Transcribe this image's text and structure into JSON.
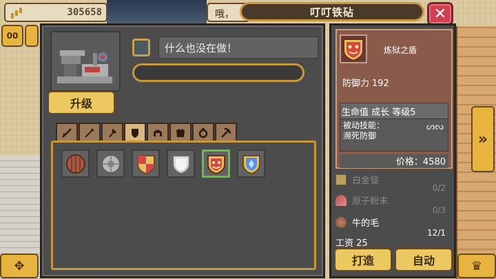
{
  "top_bar": {
    "coins": "305658",
    "message_snippet": "哦，",
    "title": "叮叮铁砧",
    "close_label": "✕"
  },
  "side_buttons": {
    "left_top": "00",
    "right_arrow": "»",
    "bottom_left": "✥",
    "bottom_right": "♛"
  },
  "workshop": {
    "upgrade_label": "升级",
    "status_text": "什么也没在做！",
    "progress": 0
  },
  "tabs": [
    {
      "icon": "sword-icon",
      "active": false
    },
    {
      "icon": "spear-icon",
      "active": false
    },
    {
      "icon": "axe-icon",
      "active": false
    },
    {
      "icon": "shield-icon",
      "active": true
    },
    {
      "icon": "helmet-icon",
      "active": false
    },
    {
      "icon": "armor-icon",
      "active": false
    },
    {
      "icon": "ring-icon",
      "active": false
    },
    {
      "icon": "pickaxe-icon",
      "active": false
    }
  ],
  "items": [
    {
      "icon": "wooden-round-shield-icon",
      "selected": false
    },
    {
      "icon": "iron-round-shield-icon",
      "selected": false
    },
    {
      "icon": "heraldic-shield-icon",
      "selected": false
    },
    {
      "icon": "silver-shield-icon",
      "selected": false
    },
    {
      "icon": "purgatory-shield-icon",
      "selected": true
    },
    {
      "icon": "crystal-shield-icon",
      "selected": false
    }
  ],
  "detail": {
    "name": "炼狱之盾",
    "defense_label": "防御力",
    "defense_value": "192",
    "tags": "生命值 成长 等级5",
    "passive_label": "被动技能：",
    "passive_skill": "濒死防御",
    "price": "价格：4580"
  },
  "materials": [
    {
      "name": "白金锭",
      "count": "0/2",
      "icon": "platinum-ingot-icon",
      "available": false
    },
    {
      "name": "原子粉末",
      "count": "0/3",
      "icon": "atomic-powder-icon",
      "available": false
    },
    {
      "name": "牛的毛",
      "count": "12/1",
      "icon": "cow-hair-icon",
      "available": true
    }
  ],
  "wage": "工资 25",
  "actions": {
    "craft_label": "打造",
    "auto_label": "自动"
  },
  "colors": {
    "panel_bg": "#4c4c4c",
    "gold_border": "#c89840",
    "button_yellow": "#ecc860",
    "close_red": "#d04050",
    "selected_green": "#6ac040"
  }
}
